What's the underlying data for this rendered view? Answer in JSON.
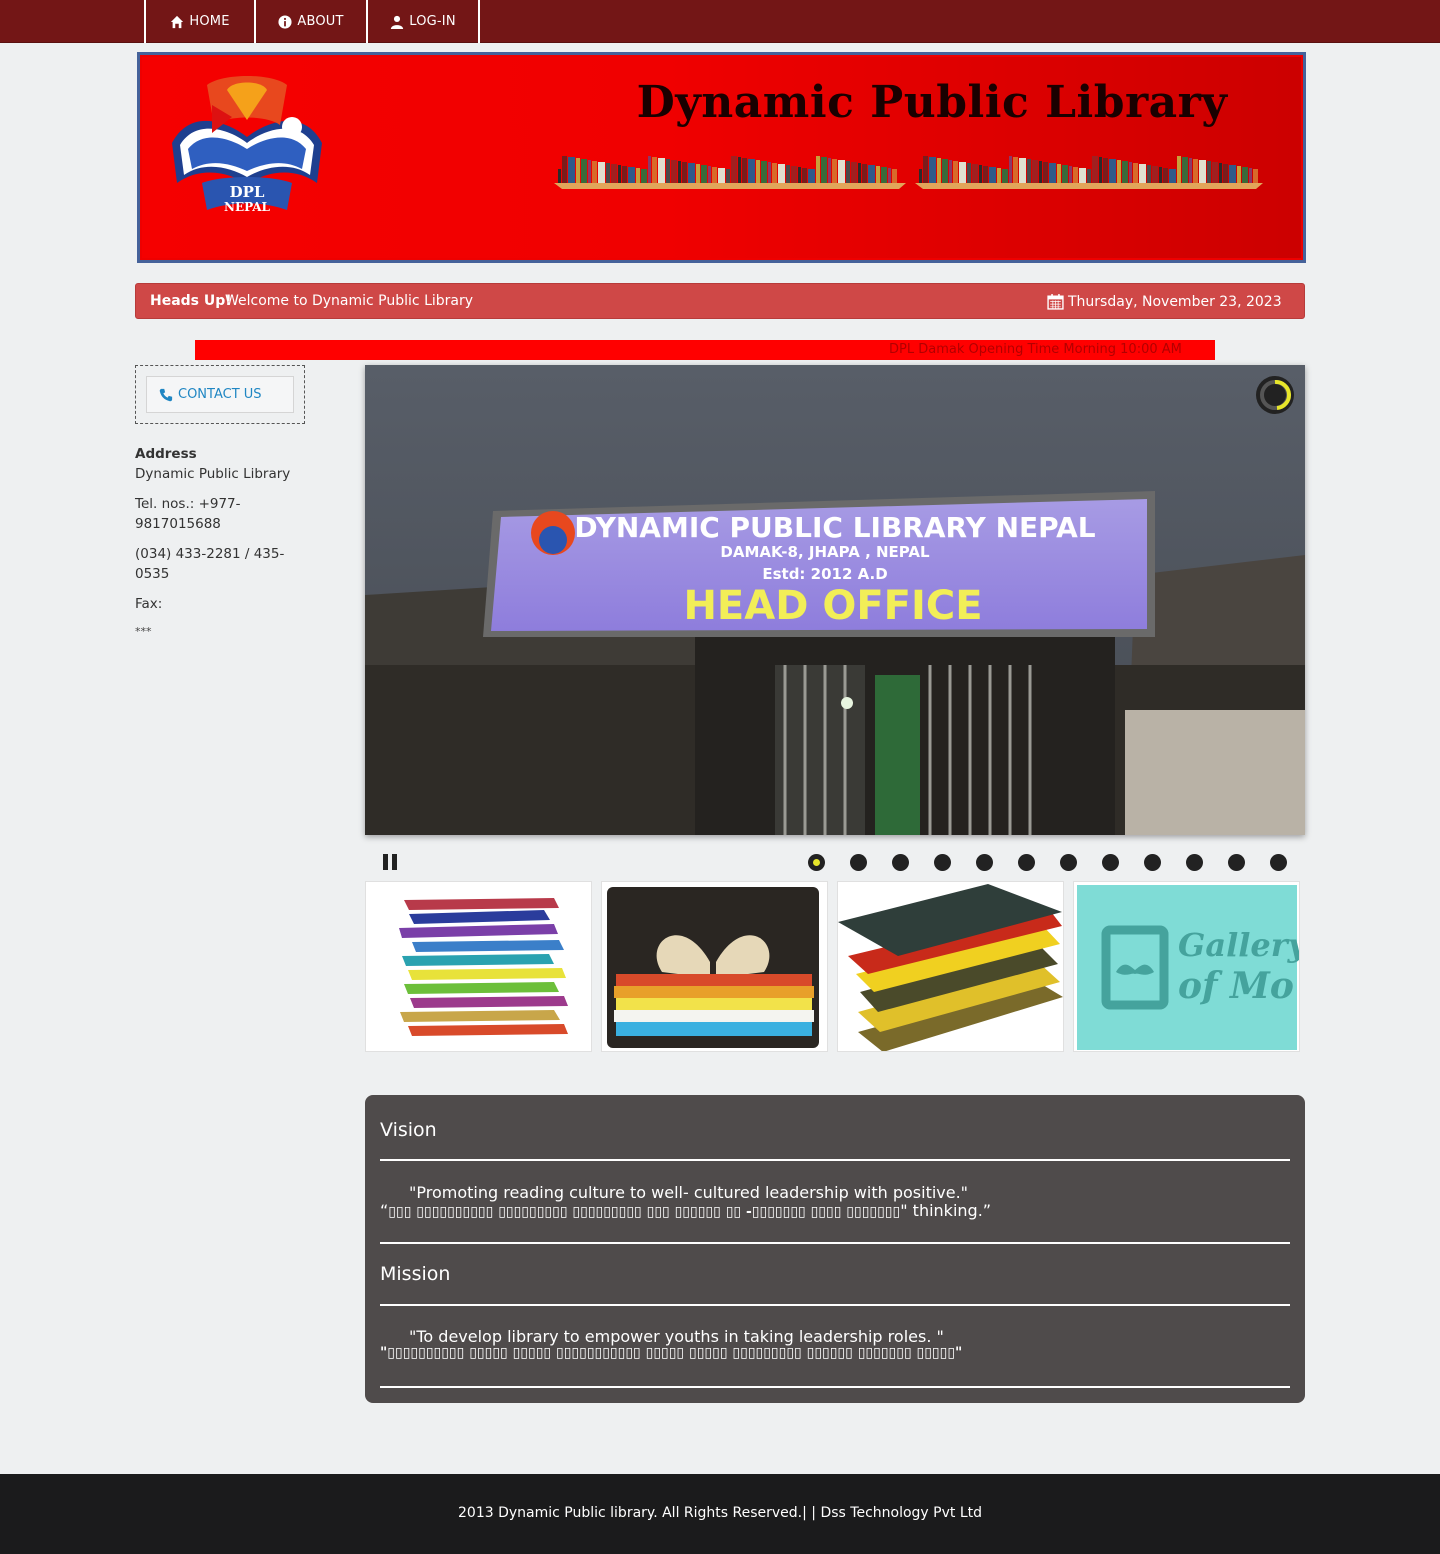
{
  "nav": {
    "home": "HOME",
    "about": "ABOUT",
    "login": "LOG-IN"
  },
  "banner": {
    "title": "Dynamic Public Library",
    "logo_text_1": "DPL",
    "logo_text_2": "NEPAL"
  },
  "alert": {
    "strong": "Heads Up!",
    "message": "Welcome to Dynamic Public Library",
    "date": "Thursday, November 23, 2023"
  },
  "marquee": {
    "text": "DPL Damak Opening Time    Morning 10:00 AM"
  },
  "sidebar": {
    "contact_label": "CONTACT US",
    "address_title": "Address",
    "address_name": "Dynamic Public Library",
    "tel": "Tel. nos.: +977-9817015688",
    "phones": "(034) 433-2281 / 435-0535",
    "fax": "Fax:",
    "stars": "***"
  },
  "slider": {
    "sign_line1": "DYNAMIC PUBLIC LIBRARY NEPAL",
    "sign_line2": "DAMAK-8, JHAPA , NEPAL",
    "sign_line3": "Estd: 2012 A.D",
    "sign_line4": "HEAD OFFICE",
    "dot_count": 12,
    "active_dot": 0
  },
  "thumb4": {
    "line1": "Gallery",
    "line2": "of Mo"
  },
  "vision_mission": {
    "vision_title": "Vision",
    "vision_en": "\"Promoting reading culture to well- cultured leadership with positive.\"",
    "vision_np_open": "“",
    "vision_np": "▯▯▯ ▯▯▯▯▯▯▯▯▯▯ ▯▯▯▯▯▯▯▯▯ ▯▯▯▯▯▯▯▯▯ ▯▯▯ ▯▯▯▯▯▯ ▯▯ -▯▯▯▯▯▯▯ ▯▯▯▯ ▯▯▯▯▯▯▯",
    "vision_np_close": "\" thinking.”",
    "mission_title": "Mission",
    "mission_en": "\"To develop library to empower youths in taking leadership roles. \"",
    "mission_np": "\"▯▯▯▯▯▯▯▯▯▯ ▯▯▯▯▯ ▯▯▯▯▯ ▯▯▯▯▯▯▯▯▯▯▯ ▯▯▯▯▯ ▯▯▯▯▯ ▯▯▯▯▯▯▯▯▯ ▯▯▯▯▯▯ ▯▯▯▯▯▯▯ ▯▯▯▯▯\""
  },
  "footer": {
    "text": "2013 Dynamic Public library. All Rights Reserved.| | Dss Technology Pvt Ltd"
  },
  "colors": {
    "nav_bg": "#731616",
    "alert_bg": "#cf4847",
    "marquee_bg": "#ff0000",
    "panel_bg": "#4f4b4b",
    "footer_bg": "#1b1b1c",
    "link_blue": "#1f86c3",
    "dot_active": "#e7e62b"
  }
}
